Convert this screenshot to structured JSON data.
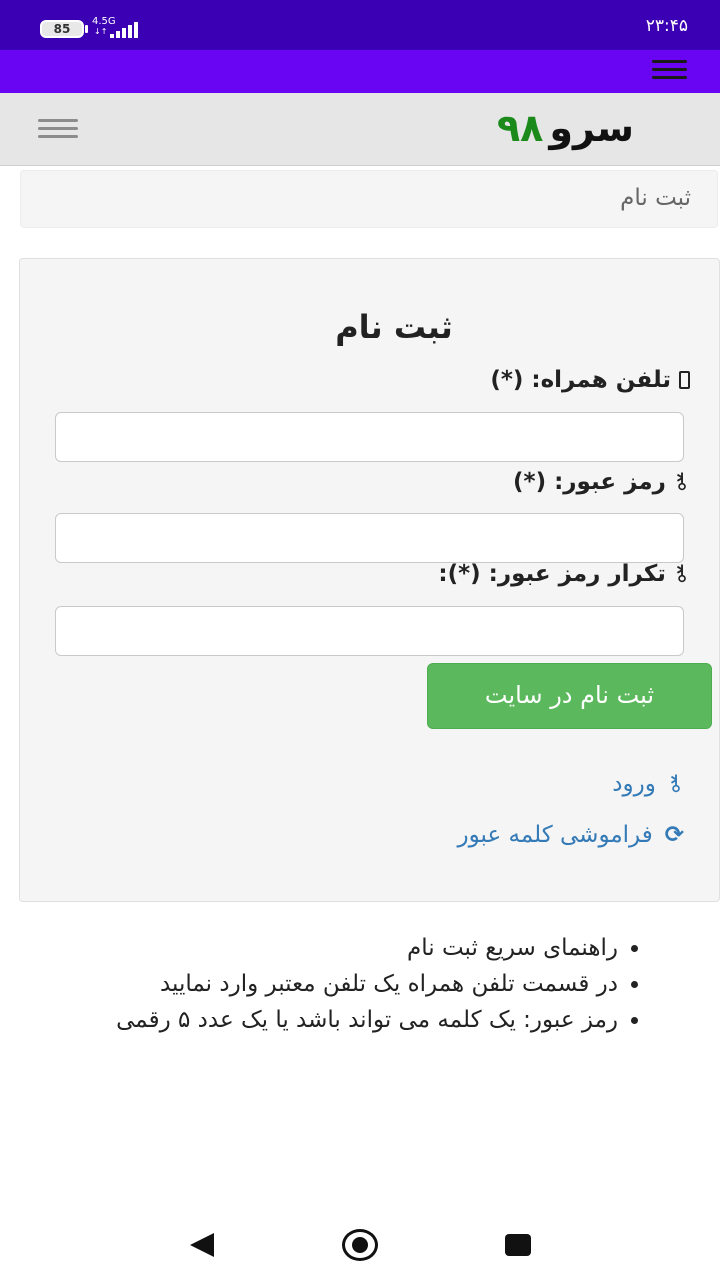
{
  "status_bar": {
    "battery": "85",
    "network": "4.5G",
    "network_arrows": "↓↑",
    "time": "۲۳:۴۵"
  },
  "header": {
    "logo_text": "سرو",
    "logo_number": "۹۸",
    "logo_number_color": "#1b8a1b"
  },
  "breadcrumb": {
    "current": "ثبت نام"
  },
  "form": {
    "title": "ثبت نام",
    "phone_label": "تلفن همراه: (*)",
    "password_label": "رمز عبور: (*)",
    "confirm_password_label": "تکرار رمز عبور: (*):",
    "phone_value": "",
    "password_value": "",
    "confirm_password_value": "",
    "submit_label": "ثبت نام در سایت",
    "login_link": "ورود",
    "forgot_link": "فراموشی کلمه عبور"
  },
  "help": {
    "items": [
      "راهنمای سریع ثبت نام",
      "در قسمت تلفن همراه یک تلفن معتبر وارد نمایید",
      "رمز عبور: یک کلمه می تواند باشد یا یک عدد ۵ رقمی"
    ]
  },
  "colors": {
    "status_bar": "#3b00b3",
    "top_nav": "#6a05f4",
    "submit": "#5cb85c",
    "link": "#337ab7"
  },
  "icons": {
    "phone": "mobile-phone-icon",
    "password": "key-icon",
    "confirm_password": "key-icon",
    "login": "key-icon",
    "forgot": "refresh-icon"
  }
}
